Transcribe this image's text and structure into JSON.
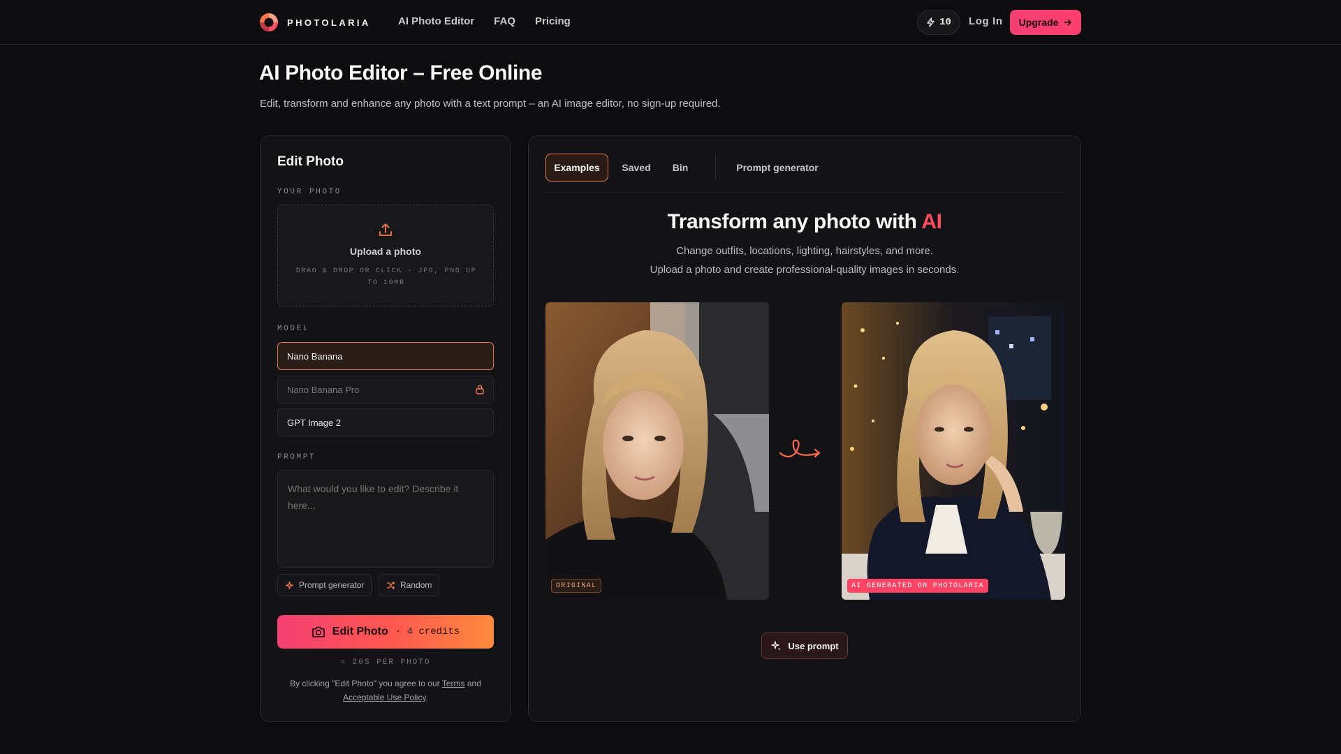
{
  "nav": {
    "brand": "PHOTOLARIA",
    "links": [
      "AI Photo Editor",
      "FAQ",
      "Pricing"
    ],
    "credits": "10",
    "login": "Log In",
    "upgrade": "Upgrade"
  },
  "header": {
    "title": "AI Photo Editor – Free Online",
    "subtitle": "Edit, transform and enhance any photo with a text prompt – an AI image editor, no sign-up required."
  },
  "editor": {
    "title": "Edit Photo",
    "photo_label": "YOUR PHOTO",
    "upload_title": "Upload a photo",
    "upload_hint": "DRAG & DROP OR CLICK · JPG, PNG UP TO 10MB",
    "model_label": "MODEL",
    "models": [
      "Nano Banana",
      "Nano Banana Pro",
      "GPT Image 2"
    ],
    "selected_model": "Nano Banana",
    "prompt_label": "PROMPT",
    "prompt_placeholder": "What would you like to edit? Describe it here...",
    "chips": [
      "Prompt generator",
      "Random"
    ],
    "button_label": "Edit Photo",
    "button_cost": "· 4 credits",
    "per_photo": "≈ 20S PER PHOTO",
    "legal_prefix": "By clicking \"Edit Photo\" you agree to our",
    "legal_terms": "Terms",
    "legal_and": "and",
    "legal_policy": "Acceptable Use Policy",
    "legal_end": "."
  },
  "showcase": {
    "tabs": [
      "Examples",
      "Saved",
      "Bin",
      "Prompt generator"
    ],
    "active_tab": "Examples",
    "hero_title": "Transform any photo with",
    "hero_accent": "AI",
    "hero_line1": "Change outfits, locations, lighting, hairstyles, and more.",
    "hero_line2": "Upload a photo and create professional-quality images in seconds.",
    "badge_original": "ORIGINAL",
    "badge_ai": "AI GENERATED ON PHOTOLARIA",
    "use_prompt": "Use prompt"
  },
  "colors": {
    "accent": "#ff4466",
    "accent_orange": "#ff8a3d",
    "background": "#0d0d0f",
    "panel": "#131315"
  },
  "icons": [
    "logo-icon",
    "bolt-icon",
    "arrow-right-icon",
    "upload-icon",
    "lock-icon",
    "sparkle-icon",
    "shuffle-icon",
    "camera-icon",
    "curly-arrow-icon",
    "magic-wand-icon"
  ]
}
